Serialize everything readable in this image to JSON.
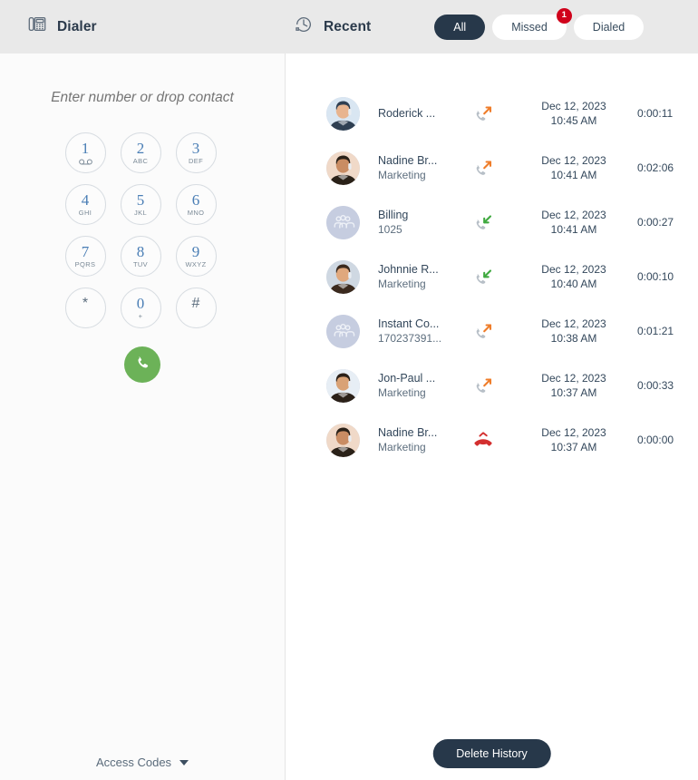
{
  "header": {
    "dialer_label": "Dialer",
    "dialer_icon": "desk-phone-icon",
    "recent_label": "Recent",
    "recent_icon": "clock-history-icon",
    "tabs": [
      {
        "label": "All",
        "active": true,
        "badge": null
      },
      {
        "label": "Missed",
        "active": false,
        "badge": "1"
      },
      {
        "label": "Dialed",
        "active": false,
        "badge": null
      }
    ]
  },
  "dialer": {
    "input_value": "",
    "input_placeholder": "Enter number or drop contact",
    "keys": [
      {
        "num": "1",
        "sub": "",
        "icon": "voicemail-icon"
      },
      {
        "num": "2",
        "sub": "ABC",
        "icon": null
      },
      {
        "num": "3",
        "sub": "DEF",
        "icon": null
      },
      {
        "num": "4",
        "sub": "GHI",
        "icon": null
      },
      {
        "num": "5",
        "sub": "JKL",
        "icon": null
      },
      {
        "num": "6",
        "sub": "MNO",
        "icon": null
      },
      {
        "num": "7",
        "sub": "PQRS",
        "icon": null
      },
      {
        "num": "8",
        "sub": "TUV",
        "icon": null
      },
      {
        "num": "9",
        "sub": "WXYZ",
        "icon": null
      },
      {
        "num": "*",
        "sub": "",
        "icon": null
      },
      {
        "num": "0",
        "sub": "+",
        "icon": null
      },
      {
        "num": "#",
        "sub": "",
        "icon": null
      }
    ],
    "call_button_icon": "phone-handset-icon",
    "access_codes_label": "Access Codes",
    "access_codes_icon": "caret-down-icon"
  },
  "recents": {
    "delete_button_label": "Delete History",
    "rows": [
      {
        "name": "Roderick ...",
        "sub": "",
        "type": "outgoing",
        "type_icon": "call-outgoing-icon",
        "date": "Dec 12, 2023",
        "time": "10:45 AM",
        "duration": "0:00:11",
        "avatar": "photo-man-1"
      },
      {
        "name": "Nadine Br...",
        "sub": "Marketing",
        "type": "outgoing",
        "type_icon": "call-outgoing-icon",
        "date": "Dec 12, 2023",
        "time": "10:41 AM",
        "duration": "0:02:06",
        "avatar": "photo-woman-1"
      },
      {
        "name": "Billing",
        "sub": "1025",
        "type": "incoming",
        "type_icon": "call-incoming-icon",
        "date": "Dec 12, 2023",
        "time": "10:41 AM",
        "duration": "0:00:27",
        "avatar": "group-icon"
      },
      {
        "name": "Johnnie R...",
        "sub": "Marketing",
        "type": "incoming",
        "type_icon": "call-incoming-icon",
        "date": "Dec 12, 2023",
        "time": "10:40 AM",
        "duration": "0:00:10",
        "avatar": "photo-man-2"
      },
      {
        "name": "Instant Co...",
        "sub": "170237391...",
        "type": "outgoing",
        "type_icon": "call-outgoing-icon",
        "date": "Dec 12, 2023",
        "time": "10:38 AM",
        "duration": "0:01:21",
        "avatar": "group-icon"
      },
      {
        "name": "Jon-Paul ...",
        "sub": "Marketing",
        "type": "outgoing",
        "type_icon": "call-outgoing-icon",
        "date": "Dec 12, 2023",
        "time": "10:37 AM",
        "duration": "0:00:33",
        "avatar": "photo-man-3"
      },
      {
        "name": "Nadine Br...",
        "sub": "Marketing",
        "type": "missed",
        "type_icon": "call-missed-icon",
        "date": "Dec 12, 2023",
        "time": "10:37 AM",
        "duration": "0:00:00",
        "avatar": "photo-woman-1"
      }
    ]
  },
  "colors": {
    "header_bg": "#e9e9e9",
    "panel_bg": "#fbfbfb",
    "dark": "#27384a",
    "accent_blue": "#4a7eb5",
    "call_green": "#6cb258",
    "outgoing_orange": "#ef7d2a",
    "incoming_green": "#3fa93f",
    "missed_red": "#d32f2f",
    "badge_red": "#d0021b"
  }
}
